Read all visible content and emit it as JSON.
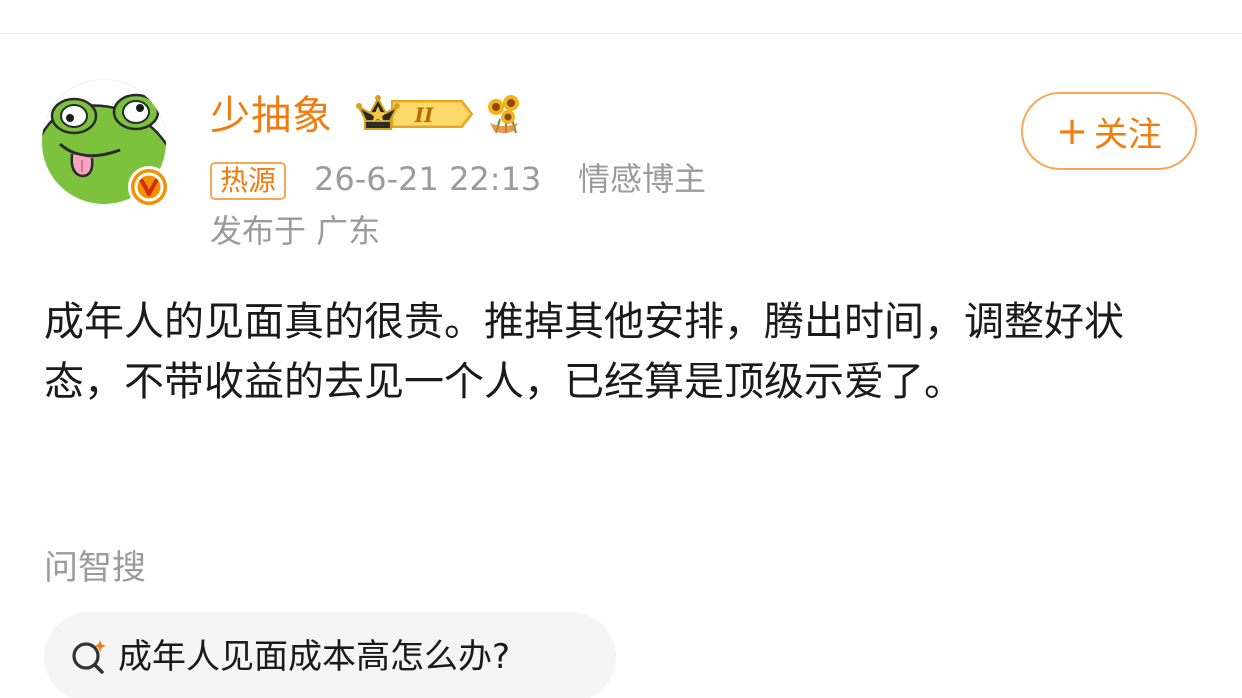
{
  "post": {
    "author": {
      "name": "少抽象",
      "avatar_icon": "frog-avatar",
      "verified_icon": "verified-v-icon",
      "vip_badge_icon": "crown-level-badge",
      "vip_level": "II",
      "decoration_icon": "sunflower-icon"
    },
    "hot_tag": "热源",
    "timestamp": "26-6-21 22:13",
    "author_type": "情感博主",
    "location": "发布于 广东",
    "follow_button": {
      "plus": "+",
      "label": "关注"
    },
    "content": "成年人的见面真的很贵。推掉其他安排，腾出时间，调整好状态，不带收益的去见一个人，已经算是顶级示爱了。"
  },
  "ai_search": {
    "label": "问智搜",
    "question": "成年人见面成本高怎么办?"
  },
  "colors": {
    "accent": "#f27b0d",
    "accent_border": "#f8a654",
    "meta_text": "#9b9b9b",
    "body_text": "#1a1a1a",
    "chip_bg": "#f5f5f5"
  }
}
